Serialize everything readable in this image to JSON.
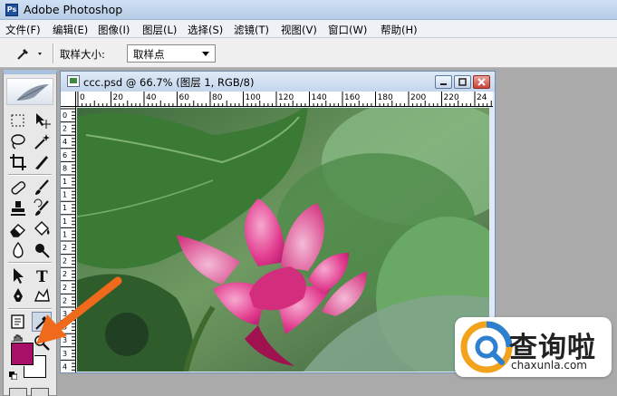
{
  "app": {
    "title": "Adobe Photoshop",
    "icon": "photoshop-app-icon"
  },
  "menu": [
    {
      "label": "文件(F)"
    },
    {
      "label": "编辑(E)"
    },
    {
      "label": "图像(I)"
    },
    {
      "label": "图层(L)"
    },
    {
      "label": "选择(S)"
    },
    {
      "label": "滤镜(T)"
    },
    {
      "label": "视图(V)"
    },
    {
      "label": "窗口(W)"
    },
    {
      "label": "帮助(H)"
    }
  ],
  "options_bar": {
    "tool_icon": "eyedropper-icon",
    "sample_size_label": "取样大小:",
    "sample_size_value": "取样点"
  },
  "toolbox": {
    "tools": [
      "rectangular-marquee-tool",
      "move-tool",
      "lasso-tool",
      "magic-wand-tool",
      "crop-tool",
      "slice-tool",
      "healing-brush-tool",
      "brush-tool",
      "clone-stamp-tool",
      "history-brush-tool",
      "eraser-tool",
      "paint-bucket-tool",
      "blur-tool",
      "dodge-tool",
      "path-selection-tool",
      "type-tool",
      "pen-tool",
      "custom-shape-tool",
      "notes-tool",
      "eyedropper-tool",
      "hand-tool",
      "zoom-tool"
    ],
    "active_tool": "eyedropper-tool",
    "type_tool_glyph": "T",
    "foreground_color": "#a80f66",
    "background_color": "#ffffff"
  },
  "document": {
    "title": "ccc.psd @ 66.7% (图层 1, RGB/8)",
    "ruler_h_labels": [
      "0",
      "20",
      "40",
      "60",
      "80",
      "100",
      "120",
      "140",
      "160",
      "180",
      "200",
      "220",
      "24"
    ],
    "ruler_v_labels": [
      "0",
      "2",
      "4",
      "6",
      "8",
      "1",
      "1",
      "1",
      "1",
      "1",
      "2",
      "2",
      "2",
      "2",
      "2",
      "3",
      "3",
      "3",
      "3",
      "4"
    ]
  },
  "watermark": {
    "name_cn": "查询啦",
    "url": "chaxunla.com"
  },
  "annotation": {
    "arrow_color": "#f06a1c"
  }
}
